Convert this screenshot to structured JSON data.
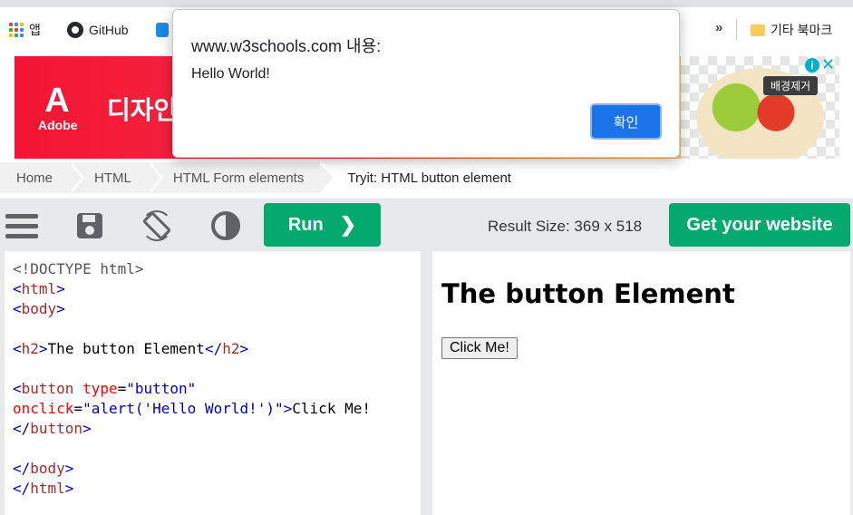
{
  "bookmarks": {
    "apps_label": "앱",
    "github_label": "GitHub",
    "more_label": "»",
    "other_label": "기타 북마크"
  },
  "ad": {
    "brand": "Adobe",
    "brand_mark": "A",
    "headline": "디자인",
    "remove_bg_label": "배경제거",
    "info_icon": "i",
    "close_icon": "✕"
  },
  "breadcrumb": {
    "items": [
      "Home",
      "HTML",
      "HTML Form elements",
      "Tryit: HTML button element"
    ]
  },
  "toolbar": {
    "run_label": "Run",
    "run_icon": "❯",
    "result_size": "Result Size: 369 x 518",
    "get_website_label": "Get your website"
  },
  "code": {
    "doctype": "<!DOCTYPE html>",
    "lines": {
      "html_open": "html",
      "body_open": "body",
      "h2_tag": "h2",
      "h2_text": "The button Element",
      "button_tag": "button",
      "type_attr": "type",
      "type_val": "\"button\"",
      "onclick_attr": "onclick",
      "onclick_val": "\"alert('Hello World!')\"",
      "button_text": "Click Me!",
      "body_close": "body",
      "html_close": "html"
    }
  },
  "result": {
    "heading": "The button Element",
    "button_label": "Click Me!"
  },
  "dialog": {
    "title": "www.w3schools.com 내용:",
    "message": "Hello World!",
    "ok_label": "확인"
  },
  "colors": {
    "run_green": "#04aa6d",
    "dialog_button_blue": "#1a73e8",
    "toolbar_bg": "#e7e9eb"
  }
}
